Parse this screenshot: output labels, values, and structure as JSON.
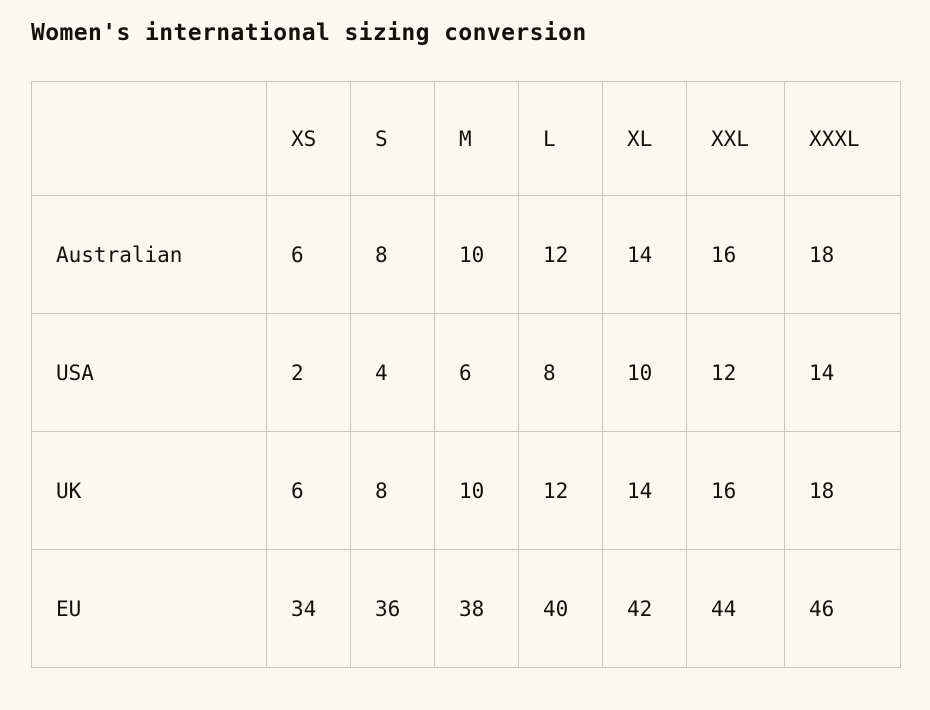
{
  "document": {
    "title": "Women's international sizing conversion",
    "background_color": "#FAF8F2",
    "border_color": "#C9C7C1",
    "text_color": "#14110D"
  },
  "table": {
    "corner_label": "",
    "headers": [
      "XS",
      "S",
      "M",
      "L",
      "XL",
      "XXL",
      "XXXL"
    ],
    "rows": [
      {
        "label": "Australian",
        "values": [
          "6",
          "8",
          "10",
          "12",
          "14",
          "16",
          "18"
        ]
      },
      {
        "label": "USA",
        "values": [
          "2",
          "4",
          "6",
          "8",
          "10",
          "12",
          "14"
        ]
      },
      {
        "label": "UK",
        "values": [
          "6",
          "8",
          "10",
          "12",
          "14",
          "16",
          "18"
        ]
      },
      {
        "label": "EU",
        "values": [
          "34",
          "36",
          "38",
          "40",
          "42",
          "44",
          "46"
        ]
      }
    ]
  }
}
